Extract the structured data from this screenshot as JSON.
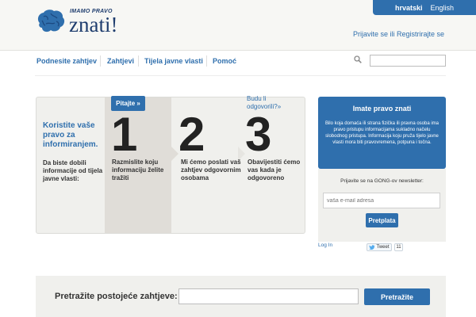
{
  "header": {
    "logo_small": "IMAMO PRAVO",
    "logo_big": "znati!",
    "languages": [
      "hrvatski",
      "English"
    ],
    "auth_link": "Prijavite se ili Registrirajte se"
  },
  "nav": {
    "items": [
      "Podnesite zahtjev",
      "Zahtjevi",
      "Tijela javne vlasti",
      "Pomoć"
    ],
    "search_placeholder": ""
  },
  "steps": {
    "intro_title": "Koristite vaše pravo za informiranjem.",
    "intro_text": "Da biste dobili informacije od tijela javne vlasti:",
    "items": [
      {
        "number": "1",
        "text": "Razmislite koju informaciju želite tražiti",
        "button": "Pitajte »"
      },
      {
        "number": "2",
        "text": "Mi ćemo poslati vaš zahtjev odgovornim osobama"
      },
      {
        "number": "3",
        "text": "Obavijestiti ćemo vas kada je odgovoreno",
        "link": "Budu li odgovorili?»"
      }
    ]
  },
  "sidebar": {
    "info_title": "Imate pravo znati",
    "info_text": "Bilo koja domaća ili strana fizička ili pravna osoba ima pravo pristupu informacijama sukladno načelu slobodnog pristupa. Informacija koju pruža tijelo javne vlasti mora biti pravovremena, potpuna i točna.",
    "newsletter_label": "Prijavite se na GONG-ov newsletter:",
    "newsletter_placeholder": "vaša e-mail adresa",
    "newsletter_button": "Pretplata",
    "login_link": "Log In",
    "tweet_label": "Tweet",
    "tweet_count": "11"
  },
  "bottom_search": {
    "label": "Pretražite postojeće zahtjeve:",
    "button": "Pretražite"
  },
  "colors": {
    "accent": "#2f6fad",
    "logo": "#1f3d6e",
    "panel_bg": "#f0f0ed"
  }
}
